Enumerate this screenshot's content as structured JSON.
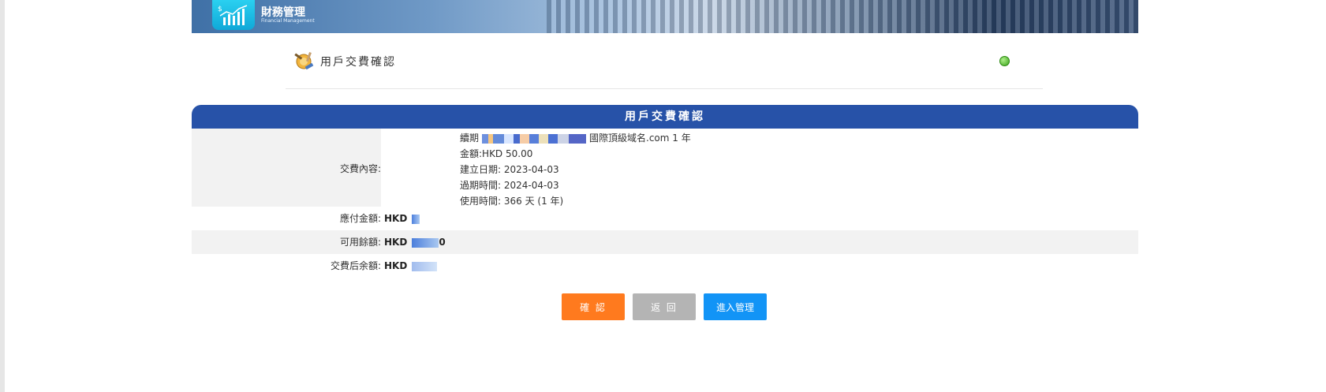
{
  "banner": {
    "title": "財務管理",
    "subtitle": "Financial Management"
  },
  "page": {
    "title": "用戶交費確認"
  },
  "panel": {
    "title": "用戶交費確認",
    "payment_content_label": "交費內容:",
    "lines": {
      "renewal_prefix": "續期",
      "renewal_suffix": "國際頂級域名.com 1 年",
      "amount": "金額:HKD  50.00",
      "created": "建立日期: 2023-04-03",
      "expiry": "過期時間: 2024-04-03",
      "duration": "使用時間: 366 天 (1 年)"
    },
    "rows": [
      {
        "label": "應付金額:",
        "value": "HKD"
      },
      {
        "label": "可用餘額:",
        "value": "HKD",
        "tail": "0"
      },
      {
        "label": "交費后余額:",
        "value": "HKD"
      }
    ]
  },
  "buttons": {
    "confirm": "確 認",
    "back": "返 回",
    "manage": "進入管理"
  }
}
